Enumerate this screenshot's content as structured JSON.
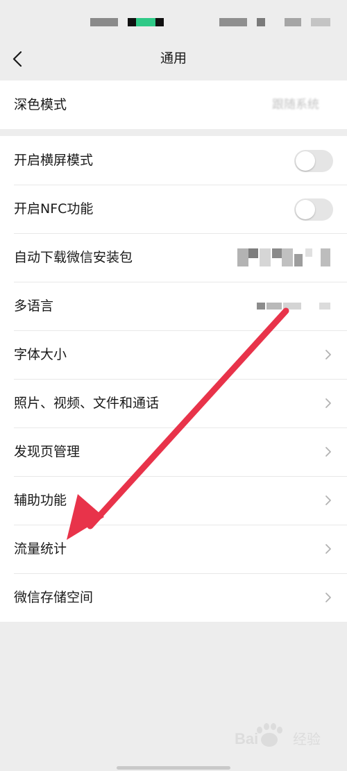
{
  "header": {
    "title": "通用",
    "back_icon": "chevron-left-icon"
  },
  "group1": {
    "dark_mode": {
      "label": "深色模式",
      "value": "跟随系统"
    }
  },
  "group2": {
    "landscape": {
      "label": "开启横屏模式",
      "enabled": false
    },
    "nfc": {
      "label": "开启NFC功能",
      "enabled": false
    },
    "auto_download": {
      "label": "自动下载微信安装包"
    },
    "language": {
      "label": "多语言"
    },
    "font_size": {
      "label": "字体大小"
    },
    "media": {
      "label": "照片、视频、文件和通话"
    },
    "discover": {
      "label": "发现页管理"
    },
    "accessibility": {
      "label": "辅助功能"
    },
    "data_usage": {
      "label": "流量统计"
    },
    "storage": {
      "label": "微信存储空间"
    }
  },
  "colors": {
    "background": "#ededed",
    "card": "#ffffff",
    "toggle_off": "#e5e5e5",
    "annotation_arrow": "#e8334a",
    "status_accent": "#2fc987"
  },
  "annotation": {
    "type": "arrow",
    "points_to": "流量统计"
  },
  "watermark": {
    "text": "Bai 经验"
  }
}
